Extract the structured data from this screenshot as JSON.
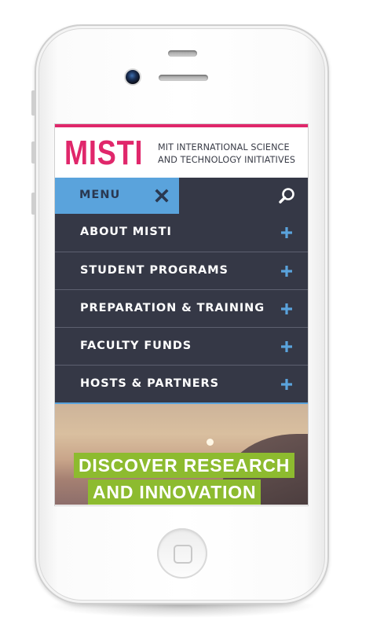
{
  "brand": {
    "logo_text": "MISTI",
    "tagline_line1": "MIT INTERNATIONAL SCIENCE",
    "tagline_line2": "AND TECHNOLOGY INITIATIVES",
    "accent_color": "#e0276b",
    "menu_color": "#5aa3dc",
    "nav_bg_color": "#353846",
    "hero_banner_color": "#8dbb2f"
  },
  "menu_bar": {
    "menu_label": "MENU",
    "close_icon": "close-icon",
    "search_icon": "search-icon"
  },
  "nav": {
    "items": [
      {
        "label": "ABOUT MISTI",
        "icon": "plus-icon"
      },
      {
        "label": "STUDENT PROGRAMS",
        "icon": "plus-icon"
      },
      {
        "label": "PREPARATION & TRAINING",
        "icon": "plus-icon"
      },
      {
        "label": "FACULTY FUNDS",
        "icon": "plus-icon"
      },
      {
        "label": "HOSTS & PARTNERS",
        "icon": "plus-icon"
      }
    ]
  },
  "hero": {
    "line1": "DISCOVER RESEARCH",
    "line2": "AND INNOVATION"
  }
}
